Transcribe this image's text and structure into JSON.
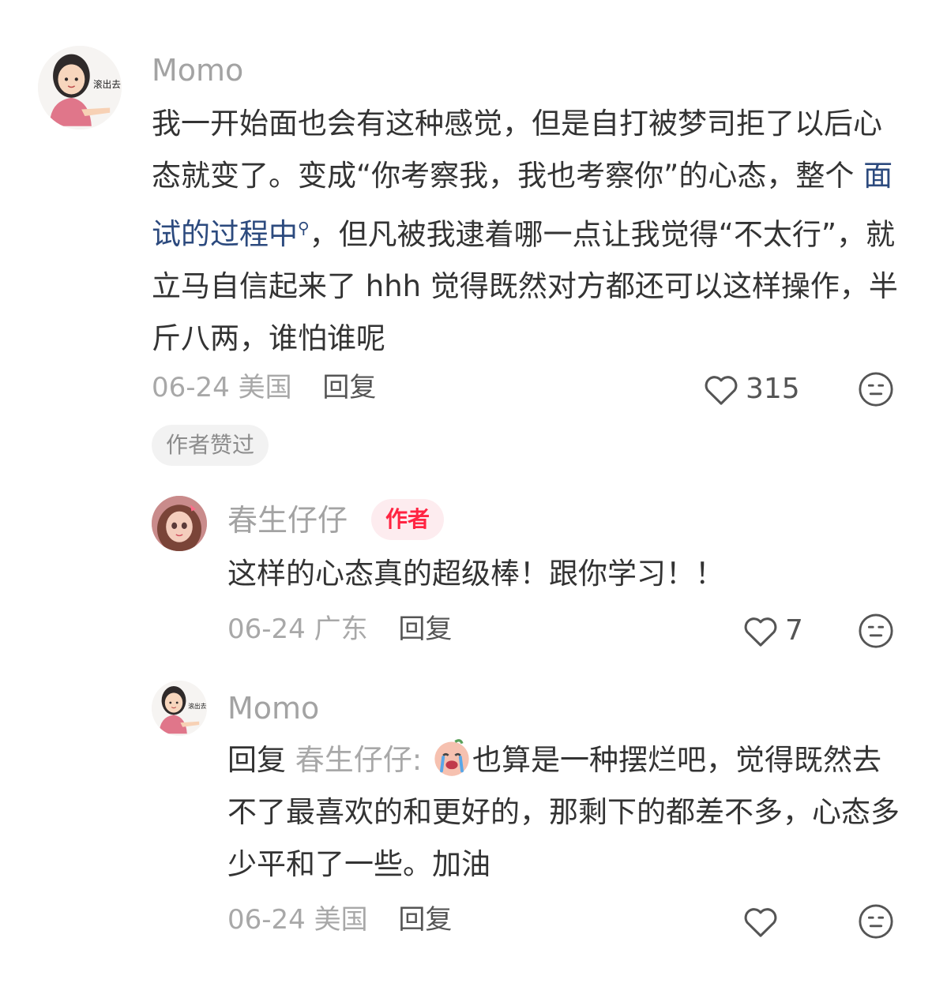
{
  "comment1": {
    "username": "Momo",
    "avatar_caption": "滚出去",
    "text_before_link": "我一开始面也会有这种感觉，但是自打被梦司拒了以后心态就变了。变成“你考察我，我也考察你”的心态，整个 ",
    "link_text": "面试的过程中",
    "text_after_link": "，但凡被我逮着哪一点让我觉得“不太行”，就立马自信起来了 hhh 觉得既然对方都还可以这样操作，半斤八两，谁怕谁呢",
    "date": "06-24",
    "location": "美国",
    "reply_label": "回复",
    "like_count": "315",
    "author_liked_label": "作者赞过"
  },
  "reply1": {
    "username": "春生仔仔",
    "author_badge": "作者",
    "text": "这样的心态真的超级棒！跟你学习！！",
    "date": "06-24",
    "location": "广东",
    "reply_label": "回复",
    "like_count": "7"
  },
  "reply2": {
    "username": "Momo",
    "avatar_caption": "滚出去",
    "reply_prefix": "回复 ",
    "mention": "春生仔仔",
    "mention_suffix": ": ",
    "text": "也算是一种摆烂吧，觉得既然去不了最喜欢的和更好的，那剩下的都差不多，心态多少平和了一些。加油",
    "date": "06-24",
    "location": "美国",
    "reply_label": "回复",
    "like_count": ""
  },
  "icons": {
    "like": "heart-outline-icon",
    "dislike": "neutral-face-icon",
    "search": "search-icon",
    "emoji": "crying-face-emoji"
  },
  "colors": {
    "link": "#2c4a7e",
    "author_badge": "#ff2442",
    "meta": "#a8a8a8"
  }
}
